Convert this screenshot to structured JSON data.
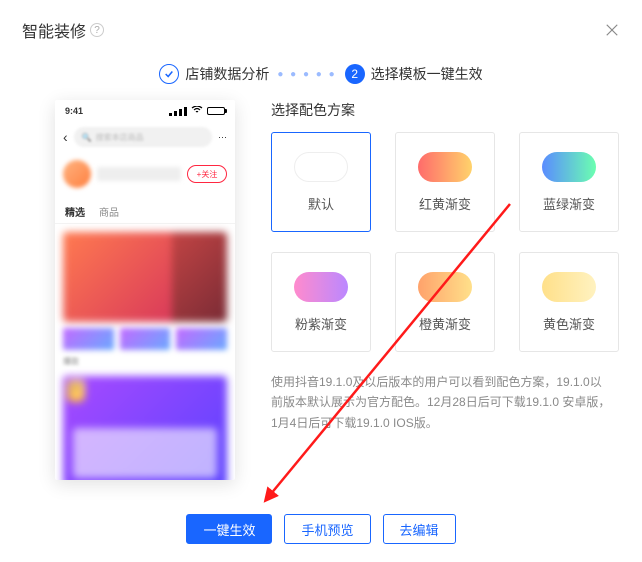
{
  "header": {
    "title": "智能装修"
  },
  "stepper": {
    "step1_label": "店铺数据分析",
    "step2_number": "2",
    "step2_label": "选择模板一键生效"
  },
  "phone": {
    "time": "9:41",
    "search_placeholder": "搜索本店商品",
    "follow_label": "+关注",
    "tabs": [
      "精选",
      "商品"
    ],
    "section_label": "爆款",
    "top_badge": "TOP 1"
  },
  "schemes": {
    "title": "选择配色方案",
    "items": [
      {
        "label": "默认",
        "swatch": "sw-default",
        "active": true
      },
      {
        "label": "红黄渐变",
        "swatch": "sw-ry",
        "active": false
      },
      {
        "label": "蓝绿渐变",
        "swatch": "sw-bg",
        "active": false
      },
      {
        "label": "粉紫渐变",
        "swatch": "sw-pp",
        "active": false
      },
      {
        "label": "橙黄渐变",
        "swatch": "sw-oy",
        "active": false
      },
      {
        "label": "黄色渐变",
        "swatch": "sw-yy",
        "active": false
      }
    ]
  },
  "notice": "使用抖音19.1.0及以后版本的用户可以看到配色方案，19.1.0以前版本默认展示为官方配色。12月28日后可下载19.1.0 安卓版，1月4日后可下载19.1.0 IOS版。",
  "footer": {
    "apply_label": "一键生效",
    "preview_label": "手机预览",
    "edit_label": "去编辑"
  }
}
